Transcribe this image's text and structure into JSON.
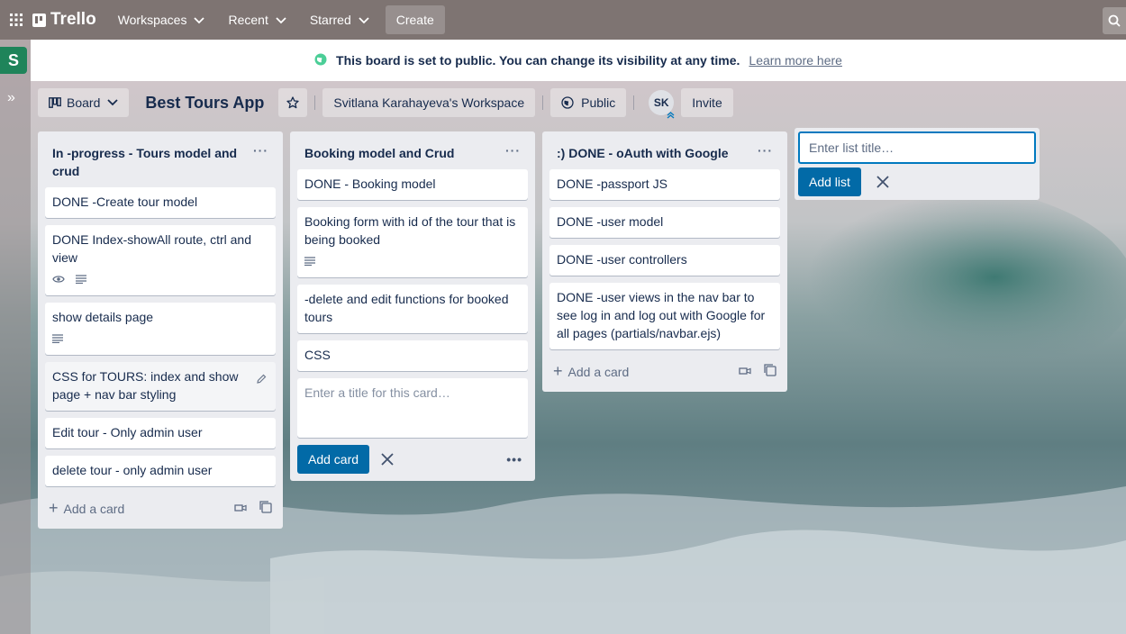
{
  "topbar": {
    "apps_icon": "grid-icon",
    "logo_text": "Trello",
    "nav": [
      {
        "label": "Workspaces"
      },
      {
        "label": "Recent"
      },
      {
        "label": "Starred"
      }
    ],
    "create_label": "Create"
  },
  "sidebar": {
    "workspace_initial": "S",
    "expand_glyph": "»"
  },
  "banner": {
    "text": "This board is set to public. You can change its visibility at any time.",
    "link": "Learn more here"
  },
  "board_header": {
    "view_label": "Board",
    "title": "Best Tours App",
    "workspace": "Svitlana Karahayeva's Workspace",
    "visibility": "Public",
    "member_initials": "SK",
    "invite_label": "Invite"
  },
  "lists": [
    {
      "title": "In -progress - Tours model and crud",
      "cards": [
        {
          "text": "DONE -Create tour model"
        },
        {
          "text": "DONE Index-showAll route, ctrl and view"
        },
        {
          "text": "show details page"
        },
        {
          "text": "CSS for TOURS: index and show page + nav bar styling"
        },
        {
          "text": "Edit tour - Only admin user"
        },
        {
          "text": "delete tour - only admin user"
        }
      ],
      "add_card_label": "Add a card"
    },
    {
      "title": "Booking model and Crud",
      "cards": [
        {
          "text": "DONE - Booking model"
        },
        {
          "text": "Booking form with id of the tour that is being booked"
        },
        {
          "text": "-delete and edit functions for booked tours"
        },
        {
          "text": "CSS"
        }
      ],
      "composer_placeholder": "Enter a title for this card…",
      "add_card_button": "Add card"
    },
    {
      "title": ":) DONE - oAuth with Google",
      "cards": [
        {
          "text": "DONE -passport JS"
        },
        {
          "text": "DONE -user model"
        },
        {
          "text": "DONE -user controllers"
        },
        {
          "text": "DONE -user views in the nav bar to see log in and log out with Google for all pages (partials/navbar.ejs)"
        }
      ],
      "add_card_label": "Add a card"
    }
  ],
  "add_list": {
    "placeholder": "Enter list title…",
    "button": "Add list"
  },
  "colors": {
    "topbar": "#766c6a",
    "list_bg": "#ebecf0",
    "primary_button": "#026aa7",
    "workspace_avatar": "#1f845a",
    "public_globe": "#4bce97"
  }
}
